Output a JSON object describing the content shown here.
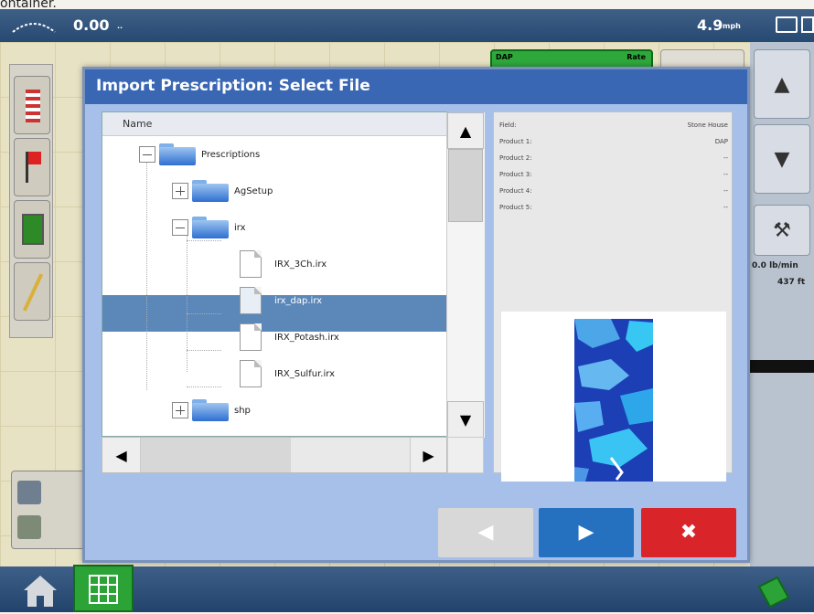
{
  "page": {
    "top_clip_text": "ontainer."
  },
  "statusbar": {
    "speed_left": "0.00",
    "unit_left": "..",
    "speed_right": "4.9",
    "unit_right": "mph"
  },
  "product_tile": {
    "name": "DAP",
    "status": "Rate"
  },
  "right_panel": {
    "rate": "0.0 lb/min",
    "feet": "437 ft"
  },
  "dialog": {
    "title": "Import Prescription: Select File",
    "tree_header": "Name",
    "nodes": [
      {
        "label": "Prescriptions",
        "type": "folder",
        "expanded": true
      },
      {
        "label": "AgSetup",
        "type": "folder",
        "expanded": false
      },
      {
        "label": "irx",
        "type": "folder",
        "expanded": true
      },
      {
        "label": "IRX_3Ch.irx",
        "type": "file"
      },
      {
        "label": "irx_dap.irx",
        "type": "file",
        "selected": true
      },
      {
        "label": "IRX_Potash.irx",
        "type": "file"
      },
      {
        "label": "IRX_Sulfur.irx",
        "type": "file"
      },
      {
        "label": "shp",
        "type": "folder",
        "expanded": false
      }
    ],
    "details": {
      "field_label": "Field:",
      "field_value": "Stone House",
      "product1_label": "Product 1:",
      "product1_value": "DAP",
      "product2_label": "Product 2:",
      "product2_value": "--",
      "product3_label": "Product 3:",
      "product3_value": "--",
      "product4_label": "Product 4:",
      "product4_value": "--",
      "product5_label": "Product 5:",
      "product5_value": "--"
    },
    "buttons": {
      "back": "◀",
      "next": "▶",
      "cancel": "✖"
    },
    "colors": {
      "title": "#3a67b4",
      "selected": "#5b88b9",
      "next": "#2670c0",
      "cancel": "#d9242a"
    }
  }
}
